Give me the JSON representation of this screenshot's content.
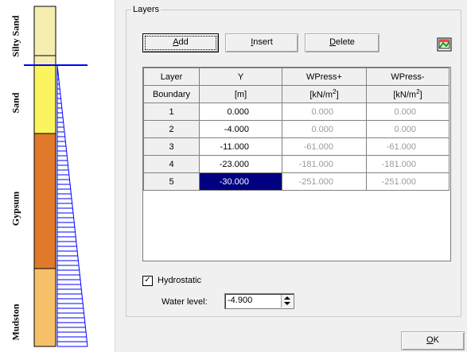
{
  "profile": {
    "layers": [
      {
        "name": "Silty Sand",
        "color": "#f5eeb0"
      },
      {
        "name": "Sand",
        "color": "#faf55e"
      },
      {
        "name": "Gypsum",
        "color": "#e07a2a"
      },
      {
        "name": "Mudston",
        "color": "#f5c068"
      }
    ],
    "water_color": "#0000ff"
  },
  "dialog": {
    "group_title": "Layers",
    "buttons": {
      "add": {
        "pre": "",
        "key": "A",
        "post": "dd"
      },
      "insert": {
        "pre": "",
        "key": "I",
        "post": "nsert"
      },
      "delete": {
        "pre": "",
        "key": "D",
        "post": "elete"
      },
      "ok": {
        "pre": "",
        "key": "O",
        "post": "K"
      }
    },
    "table": {
      "headers_top": [
        "Layer",
        "Y",
        "WPress+",
        "WPress-"
      ],
      "headers_bottom": {
        "layer": "Boundary",
        "y": "[m]",
        "wplus_pre": "[kN/m",
        "wplus_sup": "2",
        "wplus_post": "]",
        "wminus_pre": "[kN/m",
        "wminus_sup": "2",
        "wminus_post": "]"
      },
      "rows": [
        {
          "n": "1",
          "y": "0.000",
          "wplus": "0.000",
          "wminus": "0.000"
        },
        {
          "n": "2",
          "y": "-4.000",
          "wplus": "0.000",
          "wminus": "0.000"
        },
        {
          "n": "3",
          "y": "-11.000",
          "wplus": "-61.000",
          "wminus": "-61.000"
        },
        {
          "n": "4",
          "y": "-23.000",
          "wplus": "-181.000",
          "wminus": "-181.000"
        },
        {
          "n": "5",
          "y": "-30.000",
          "wplus": "-251.000",
          "wminus": "-251.000"
        }
      ],
      "selected_row": 5
    },
    "hydrostatic": {
      "label": "Hydrostatic",
      "checked": "✓"
    },
    "water_level": {
      "label": "Water level:",
      "value": "-4.900"
    }
  }
}
